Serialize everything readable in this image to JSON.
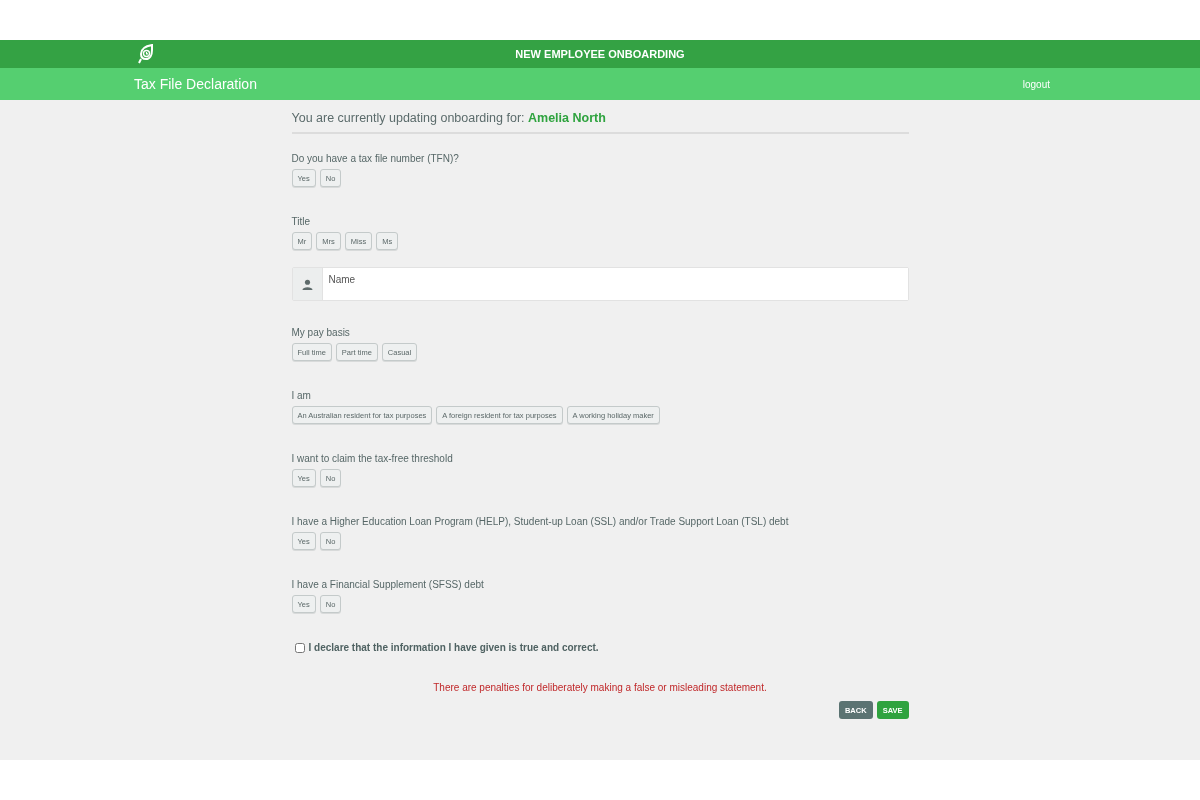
{
  "app_bar": {
    "title": "NEW EMPLOYEE ONBOARDING"
  },
  "sub_bar": {
    "title": "Tax File Declaration",
    "logout": "logout"
  },
  "heading": {
    "prefix": "You are currently updating onboarding for:",
    "name": "Amelia North"
  },
  "questions": [
    {
      "kind": "choice",
      "label": "Do you have a tax file number (TFN)?",
      "options": [
        {
          "label": "Yes",
          "selected": false
        },
        {
          "label": "No",
          "selected": false
        }
      ]
    },
    {
      "kind": "choice",
      "label": "Title",
      "options": [
        {
          "label": "Mr",
          "selected": false
        },
        {
          "label": "Mrs",
          "selected": false
        },
        {
          "label": "Miss",
          "selected": false
        },
        {
          "label": "Ms",
          "selected": false
        }
      ],
      "field": {
        "placeholder": "Name"
      }
    },
    {
      "kind": "choice",
      "label": "My pay basis",
      "options": [
        {
          "label": "Full time",
          "selected": false
        },
        {
          "label": "Part time",
          "selected": false
        },
        {
          "label": "Casual",
          "selected": false
        }
      ]
    },
    {
      "kind": "choice",
      "label": "I am",
      "options": [
        {
          "label": "An Australian resident for tax purposes",
          "selected": false
        },
        {
          "label": "A foreign resident for tax purposes",
          "selected": false
        },
        {
          "label": "A working holiday maker",
          "selected": false
        }
      ]
    },
    {
      "kind": "choice",
      "label": "I want to claim the tax-free threshold",
      "options": [
        {
          "label": "Yes",
          "selected": false
        },
        {
          "label": "No",
          "selected": false
        }
      ]
    },
    {
      "kind": "choice",
      "label": "I have a Higher Education Loan Program (HELP), Student-up Loan (SSL) and/or Trade Support Loan (TSL) debt",
      "options": [
        {
          "label": "Yes",
          "selected": false
        },
        {
          "label": "No",
          "selected": false
        }
      ]
    },
    {
      "kind": "choice",
      "label": "I have a Financial Supplement (SFSS) debt",
      "options": [
        {
          "label": "Yes",
          "selected": false
        },
        {
          "label": "No",
          "selected": false
        }
      ]
    }
  ],
  "declaration": {
    "label": "I declare that the information I have given is true and correct.",
    "checked": false
  },
  "warning": "There are penalties for deliberately making a false or misleading statement.",
  "buttons": [
    {
      "kind": "back",
      "label": "BACK"
    },
    {
      "kind": "save",
      "label": "SAVE"
    }
  ]
}
